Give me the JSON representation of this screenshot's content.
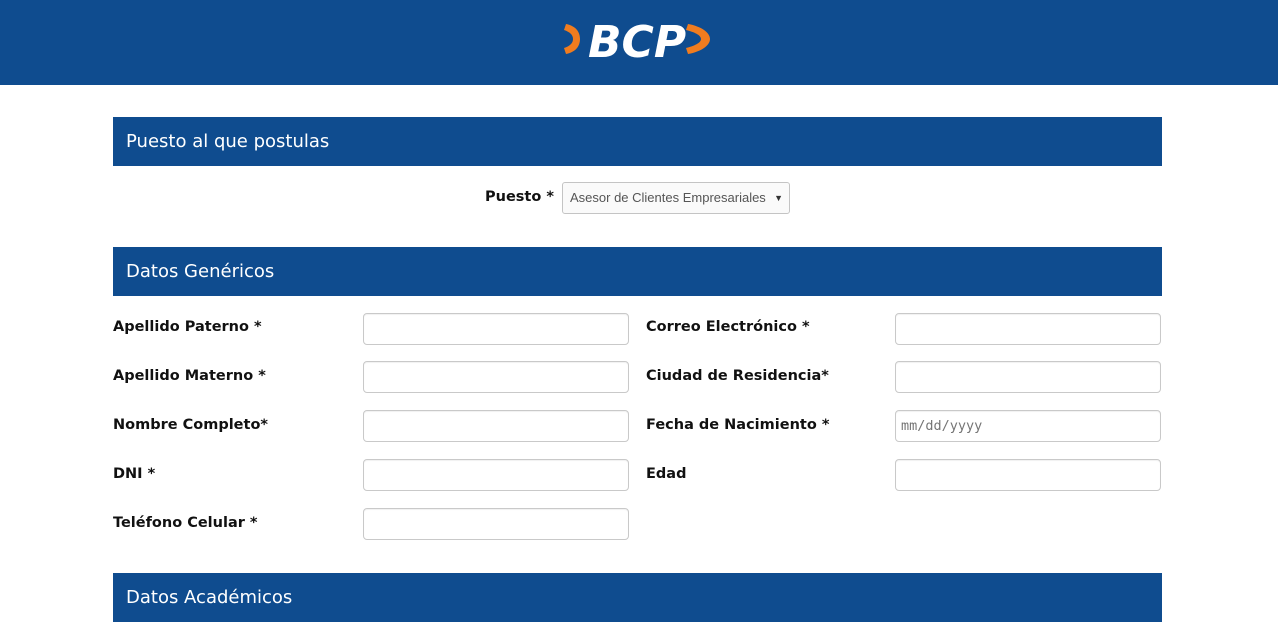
{
  "header": {
    "logo_text": "BCP",
    "colors": {
      "brand_blue": "#0f4c8f",
      "accent_orange": "#f07c1f"
    }
  },
  "sections": {
    "puesto_title": "Puesto al que postulas",
    "genericos_title": "Datos Genéricos",
    "academicos_title": "Datos Académicos"
  },
  "puesto": {
    "label": "Puesto *",
    "selected": "Asesor de Clientes Empresariales",
    "caret_icon": "caret-down-icon"
  },
  "form": {
    "apellido_paterno": {
      "label": "Apellido Paterno *",
      "value": ""
    },
    "apellido_materno": {
      "label": "Apellido Materno *",
      "value": ""
    },
    "nombre_completo": {
      "label": "Nombre Completo*",
      "value": ""
    },
    "dni": {
      "label": "DNI *",
      "value": ""
    },
    "telefono_celular": {
      "label": "Teléfono Celular *",
      "value": ""
    },
    "correo_electronico": {
      "label": "Correo Electrónico *",
      "value": ""
    },
    "ciudad_residencia": {
      "label": "Ciudad de Residencia*",
      "value": ""
    },
    "fecha_nacimiento": {
      "label": "Fecha de Nacimiento *",
      "placeholder": "mm/dd/yyyy",
      "value": ""
    },
    "edad": {
      "label": "Edad",
      "value": ""
    }
  }
}
